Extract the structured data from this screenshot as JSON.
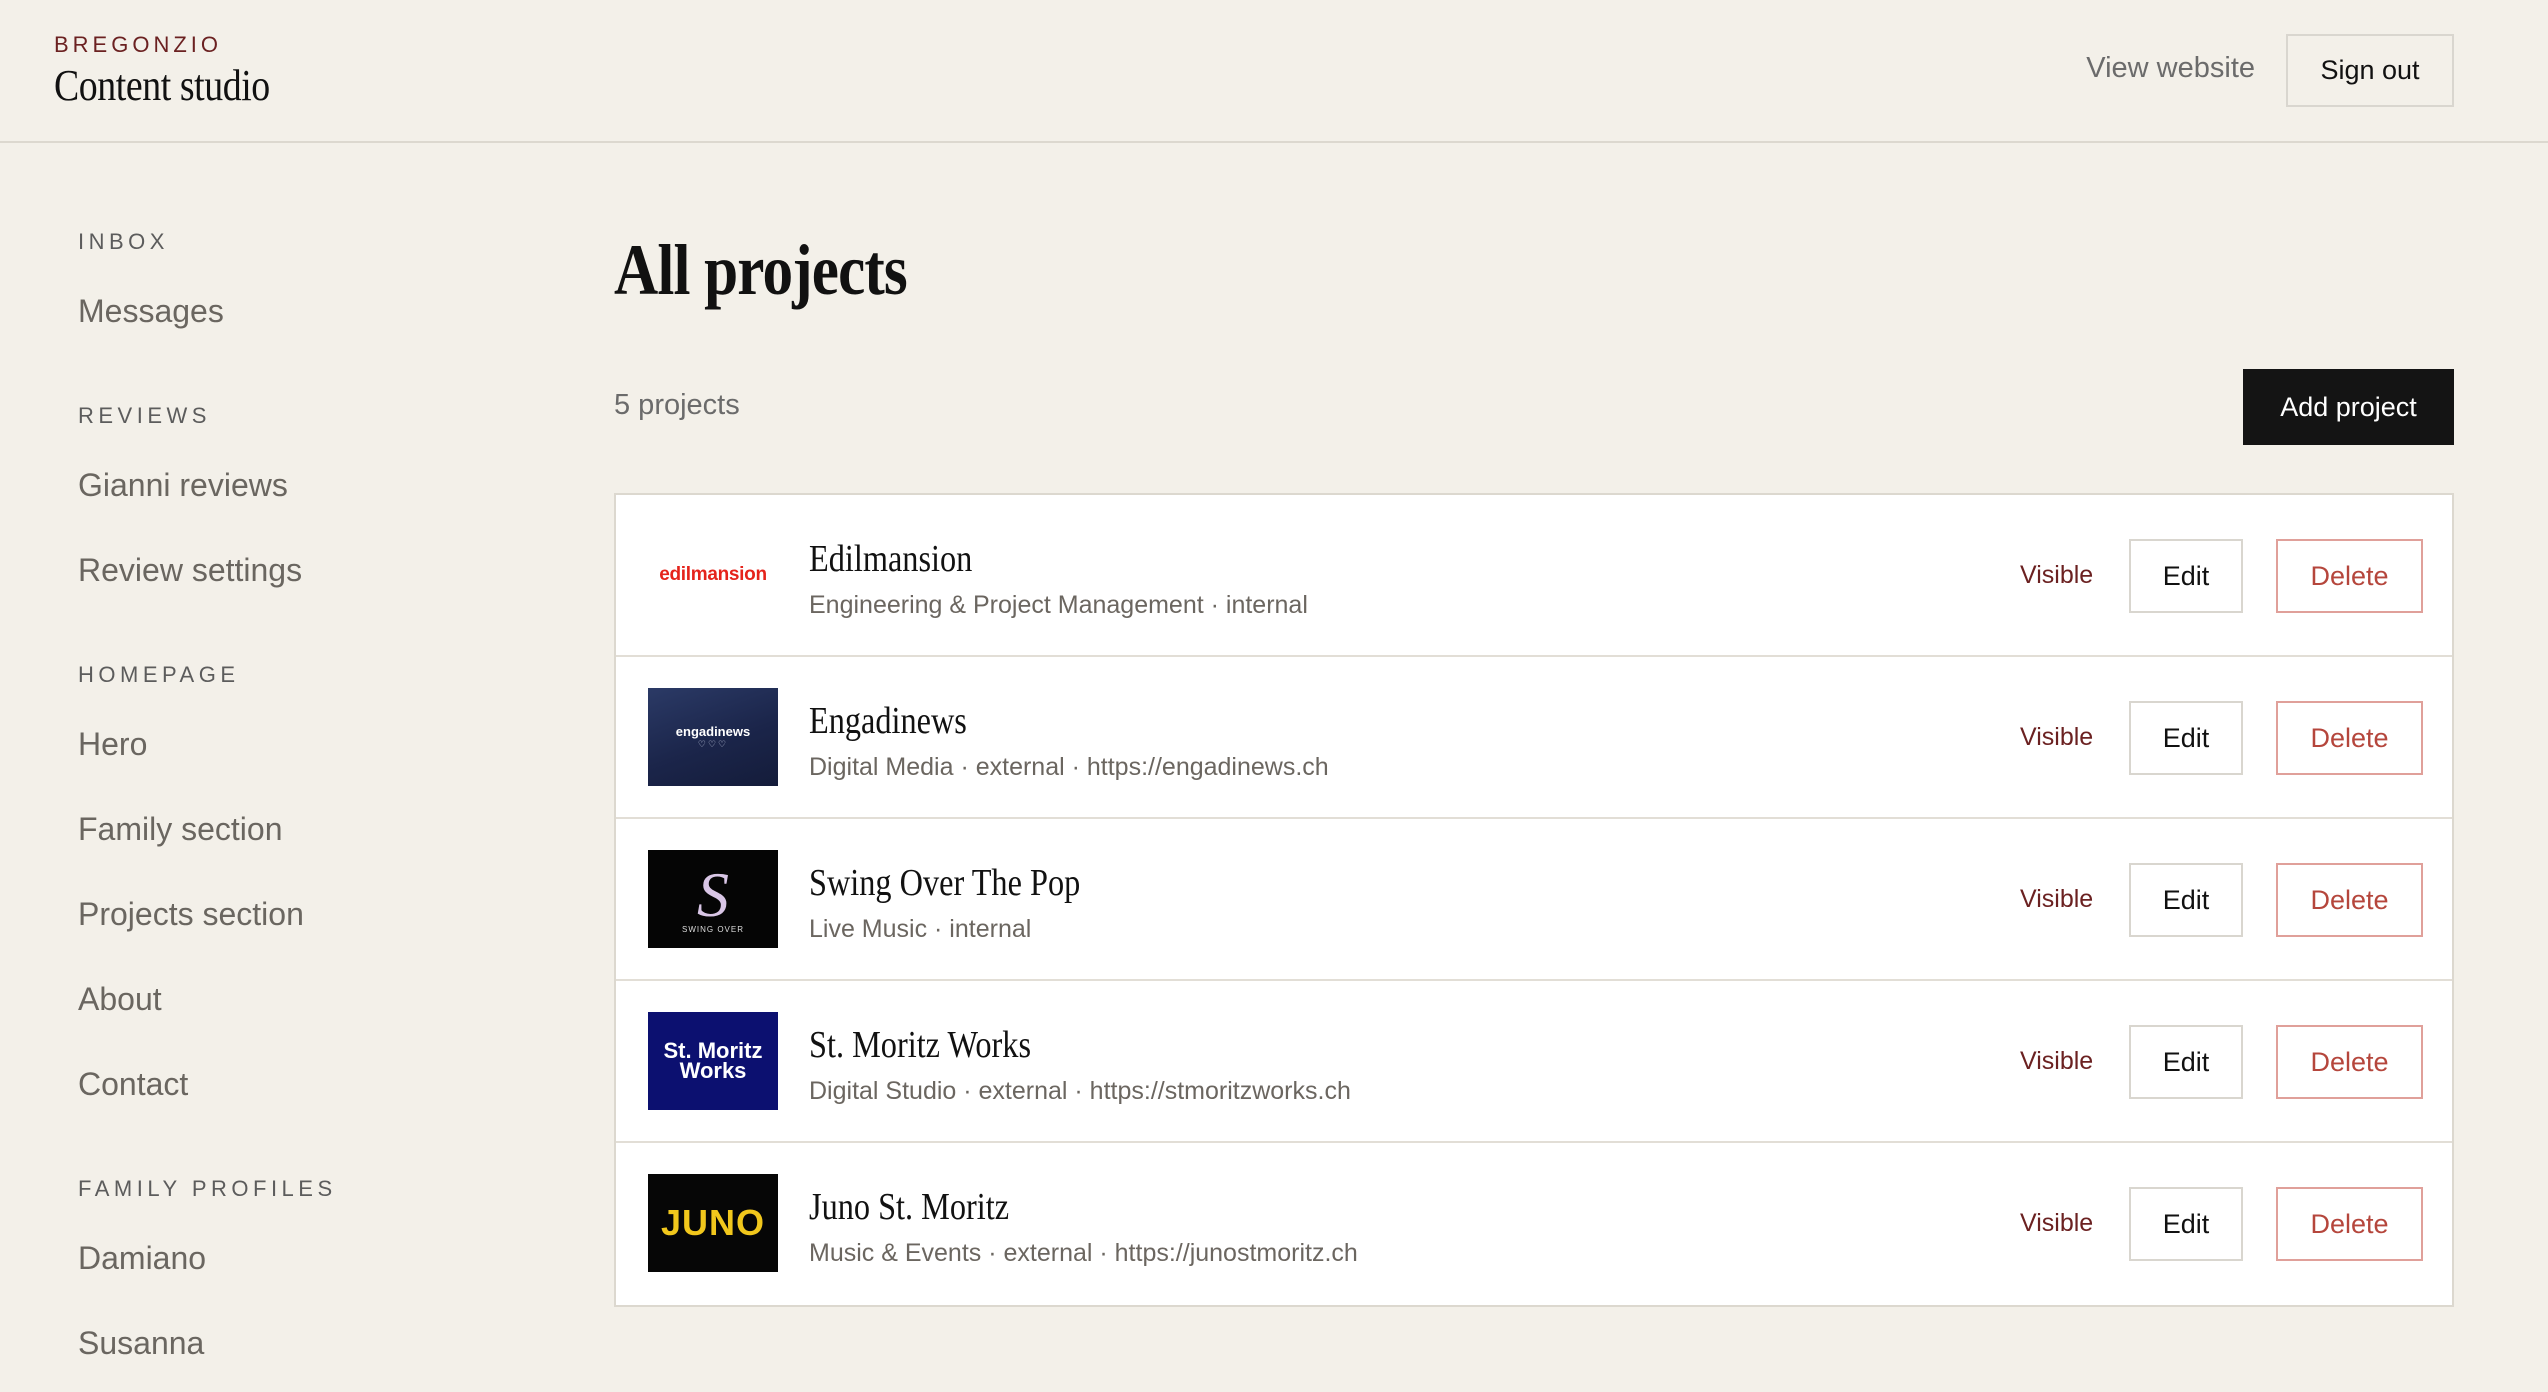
{
  "header": {
    "brand_kicker": "BREGONZIO",
    "brand_title": "Content studio",
    "view_website": "View website",
    "sign_out": "Sign out"
  },
  "sidebar": {
    "groups": [
      {
        "title": "INBOX",
        "items": [
          "Messages"
        ]
      },
      {
        "title": "REVIEWS",
        "items": [
          "Gianni reviews",
          "Review settings"
        ]
      },
      {
        "title": "HOMEPAGE",
        "items": [
          "Hero",
          "Family section",
          "Projects section",
          "About",
          "Contact"
        ]
      },
      {
        "title": "FAMILY PROFILES",
        "items": [
          "Damiano",
          "Susanna"
        ]
      }
    ]
  },
  "main": {
    "title": "All projects",
    "count": "5 projects",
    "add_button": "Add project",
    "projects": [
      {
        "name": "Edilmansion",
        "meta": "Engineering & Project Management · internal",
        "status": "Visible",
        "edit": "Edit",
        "delete": "Delete",
        "logo_text": "edilmansion",
        "logo_sub": ""
      },
      {
        "name": "Engadinews",
        "meta": "Digital Media · external · https://engadinews.ch",
        "status": "Visible",
        "edit": "Edit",
        "delete": "Delete",
        "logo_text": "engadinews",
        "logo_sub": "♡♡♡"
      },
      {
        "name": "Swing Over The Pop",
        "meta": "Live Music · internal",
        "status": "Visible",
        "edit": "Edit",
        "delete": "Delete",
        "logo_text": "S",
        "logo_sub": "SWING OVER"
      },
      {
        "name": "St. Moritz Works",
        "meta": "Digital Studio · external · https://stmoritzworks.ch",
        "status": "Visible",
        "edit": "Edit",
        "delete": "Delete",
        "logo_text": "St. Moritz Works",
        "logo_sub": ""
      },
      {
        "name": "Juno St. Moritz",
        "meta": "Music & Events · external · https://junostmoritz.ch",
        "status": "Visible",
        "edit": "Edit",
        "delete": "Delete",
        "logo_text": "JUNO",
        "logo_sub": ""
      }
    ]
  },
  "colors": {
    "background": "#f3f0e9",
    "accent_dark_red": "#6b2121",
    "delete_red": "#b5463c",
    "primary_button": "#141414"
  }
}
